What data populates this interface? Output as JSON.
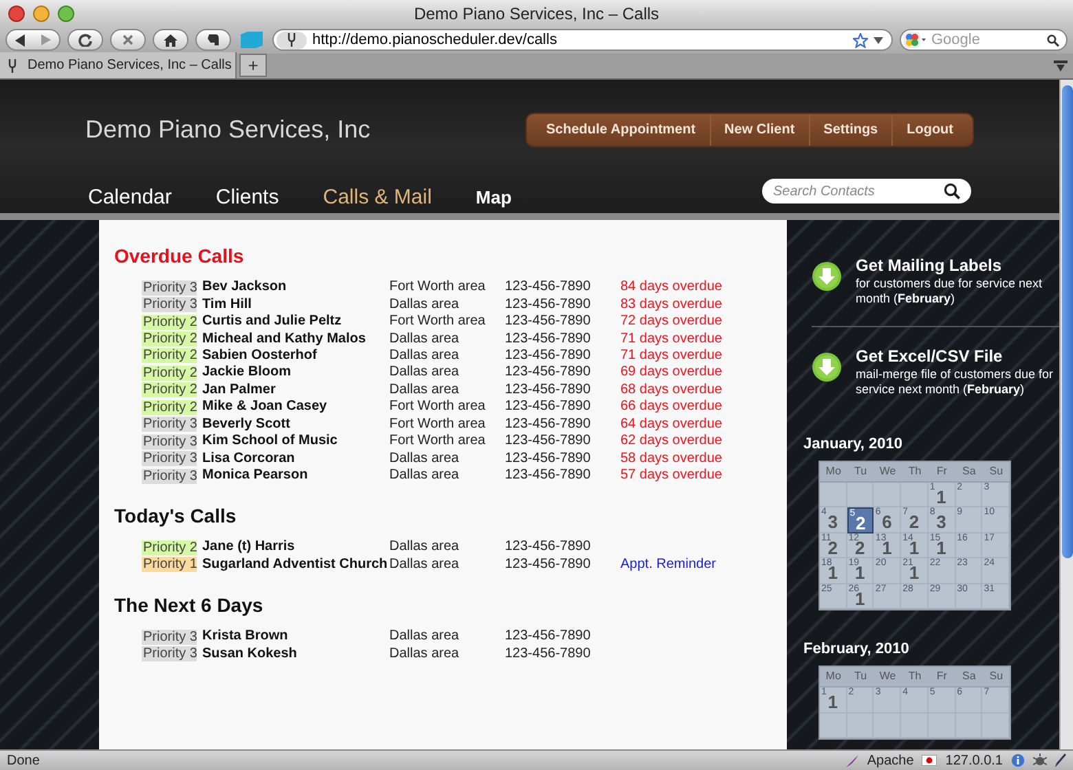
{
  "browser": {
    "title": "Demo Piano Services, Inc – Calls",
    "url": "http://demo.pianoscheduler.dev/calls",
    "search_placeholder": "Google",
    "tab": {
      "title": "Demo Piano Services, Inc – Calls"
    },
    "new_tab": "+"
  },
  "header": {
    "logo": "Demo Piano Services, Inc",
    "actions": [
      "Schedule Appointment",
      "New Client",
      "Settings",
      "Logout"
    ],
    "nav": [
      {
        "label": "Calendar",
        "selected": false
      },
      {
        "label": "Clients",
        "selected": false
      },
      {
        "label": "Calls & Mail",
        "selected": true
      },
      {
        "label": "Map",
        "selected": false
      }
    ],
    "search_placeholder": "Search Contacts"
  },
  "sections": [
    {
      "title": "Overdue Calls",
      "kind": "alert",
      "rows": [
        {
          "priority": "Priority 3",
          "color": "#dcdcdc",
          "name": "Bev Jackson",
          "area": "Fort Worth area",
          "phone": "123-456-7890",
          "overdue": "84 days overdue"
        },
        {
          "priority": "Priority 3",
          "color": "#dcdcdc",
          "name": "Tim Hill",
          "area": "Dallas area",
          "phone": "123-456-7890",
          "overdue": "83 days overdue"
        },
        {
          "priority": "Priority 2",
          "color": "#d6f7a3",
          "name": "Curtis and Julie Peltz",
          "area": "Fort Worth area",
          "phone": "123-456-7890",
          "overdue": "72 days overdue"
        },
        {
          "priority": "Priority 2",
          "color": "#d6f7a3",
          "name": "Micheal and Kathy Malos",
          "area": "Dallas area",
          "phone": "123-456-7890",
          "overdue": "71 days overdue"
        },
        {
          "priority": "Priority 2",
          "color": "#d6f7a3",
          "name": "Sabien Oosterhof",
          "area": "Dallas area",
          "phone": "123-456-7890",
          "overdue": "71 days overdue"
        },
        {
          "priority": "Priority 2",
          "color": "#d6f7a3",
          "name": "Jackie Bloom",
          "area": "Dallas area",
          "phone": "123-456-7890",
          "overdue": "69 days overdue"
        },
        {
          "priority": "Priority 2",
          "color": "#d6f7a3",
          "name": "Jan Palmer",
          "area": "Dallas area",
          "phone": "123-456-7890",
          "overdue": "68 days overdue"
        },
        {
          "priority": "Priority 2",
          "color": "#d6f7a3",
          "name": "Mike & Joan Casey",
          "area": "Fort Worth area",
          "phone": "123-456-7890",
          "overdue": "66 days overdue"
        },
        {
          "priority": "Priority 3",
          "color": "#dcdcdc",
          "name": "Beverly Scott",
          "area": "Fort Worth area",
          "phone": "123-456-7890",
          "overdue": "64 days overdue"
        },
        {
          "priority": "Priority 3",
          "color": "#dcdcdc",
          "name": "Kim School of Music",
          "area": "Fort Worth area",
          "phone": "123-456-7890",
          "overdue": "62 days overdue"
        },
        {
          "priority": "Priority 3",
          "color": "#dcdcdc",
          "name": "Lisa Corcoran",
          "area": "Dallas area",
          "phone": "123-456-7890",
          "overdue": "58 days overdue"
        },
        {
          "priority": "Priority 3",
          "color": "#dcdcdc",
          "name": "Monica Pearson",
          "area": "Dallas area",
          "phone": "123-456-7890",
          "overdue": "57 days overdue"
        }
      ]
    },
    {
      "title": "Today's Calls",
      "kind": "normal",
      "rows": [
        {
          "priority": "Priority 2",
          "color": "#d6f7a3",
          "name": "Jane (t) Harris",
          "area": "Dallas area",
          "phone": "123-456-7890"
        },
        {
          "priority": "Priority 1",
          "color": "#fcd99c",
          "name": "Sugarland Adventist Church",
          "area": "Dallas area",
          "phone": "123-456-7890",
          "link": "Appt. Reminder"
        }
      ]
    },
    {
      "title": "The Next 6 Days",
      "kind": "normal",
      "rows": [
        {
          "priority": "Priority 3",
          "color": "#dcdcdc",
          "name": "Krista Brown",
          "area": "Dallas area",
          "phone": "123-456-7890"
        },
        {
          "priority": "Priority 3",
          "color": "#dcdcdc",
          "name": "Susan Kokesh",
          "area": "Dallas area",
          "phone": "123-456-7890"
        }
      ]
    }
  ],
  "downloads": [
    {
      "title": "Get Mailing Labels",
      "description": "for customers due for service next month (**February**)"
    },
    {
      "title": "Get Excel/CSV File",
      "description": "mail-merge file of customers due for service next month (**February**)"
    }
  ],
  "calendars": [
    {
      "title": "January, 2010",
      "weekdays": [
        "Mo",
        "Tu",
        "We",
        "Th",
        "Fr",
        "Sa",
        "Su"
      ],
      "weeks": [
        [
          {
            "kind": "blank"
          },
          {
            "kind": "blank"
          },
          {
            "kind": "blank"
          },
          {
            "kind": "blank"
          },
          {
            "kind": "day",
            "day": "1",
            "count": "1",
            "selected": false
          },
          {
            "kind": "day",
            "day": "2",
            "selected": false
          },
          {
            "kind": "day",
            "day": "3",
            "selected": false
          }
        ],
        [
          {
            "kind": "day",
            "day": "4",
            "count": "3",
            "selected": false
          },
          {
            "kind": "day",
            "day": "5",
            "count": "2",
            "selected": true
          },
          {
            "kind": "day",
            "day": "6",
            "count": "6",
            "selected": false
          },
          {
            "kind": "day",
            "day": "7",
            "count": "2",
            "selected": false
          },
          {
            "kind": "day",
            "day": "8",
            "count": "3",
            "selected": false
          },
          {
            "kind": "day",
            "day": "9",
            "selected": false
          },
          {
            "kind": "day",
            "day": "10",
            "selected": false
          }
        ],
        [
          {
            "kind": "day",
            "day": "11",
            "count": "2",
            "selected": false
          },
          {
            "kind": "day",
            "day": "12",
            "count": "2",
            "selected": false
          },
          {
            "kind": "day",
            "day": "13",
            "count": "1",
            "selected": false
          },
          {
            "kind": "day",
            "day": "14",
            "count": "1",
            "selected": false
          },
          {
            "kind": "day",
            "day": "15",
            "count": "1",
            "selected": false
          },
          {
            "kind": "day",
            "day": "16",
            "selected": false
          },
          {
            "kind": "day",
            "day": "17",
            "selected": false
          }
        ],
        [
          {
            "kind": "day",
            "day": "18",
            "count": "1",
            "selected": false
          },
          {
            "kind": "day",
            "day": "19",
            "count": "1",
            "selected": false
          },
          {
            "kind": "day",
            "day": "20",
            "selected": false
          },
          {
            "kind": "day",
            "day": "21",
            "count": "1",
            "selected": false
          },
          {
            "kind": "day",
            "day": "22",
            "selected": false
          },
          {
            "kind": "day",
            "day": "23",
            "selected": false
          },
          {
            "kind": "day",
            "day": "24",
            "selected": false
          }
        ],
        [
          {
            "kind": "day",
            "day": "25",
            "selected": false
          },
          {
            "kind": "day",
            "day": "26",
            "count": "1",
            "selected": false
          },
          {
            "kind": "day",
            "day": "27",
            "selected": false
          },
          {
            "kind": "day",
            "day": "28",
            "selected": false
          },
          {
            "kind": "day",
            "day": "29",
            "selected": false
          },
          {
            "kind": "day",
            "day": "30",
            "selected": false
          },
          {
            "kind": "day",
            "day": "31",
            "selected": false
          }
        ]
      ]
    },
    {
      "title": "February, 2010",
      "weekdays": [
        "Mo",
        "Tu",
        "We",
        "Th",
        "Fr",
        "Sa",
        "Su"
      ],
      "weeks": [
        [
          {
            "kind": "day",
            "day": "1",
            "count": "1",
            "selected": false
          },
          {
            "kind": "day",
            "day": "2",
            "selected": false
          },
          {
            "kind": "day",
            "day": "3",
            "selected": false
          },
          {
            "kind": "day",
            "day": "4",
            "selected": false
          },
          {
            "kind": "day",
            "day": "5",
            "selected": false
          },
          {
            "kind": "day",
            "day": "6",
            "selected": false
          },
          {
            "kind": "day",
            "day": "7",
            "selected": false
          }
        ]
      ]
    }
  ],
  "status_bar": {
    "text": "Done",
    "server": "Apache",
    "address": "127.0.0.1"
  }
}
